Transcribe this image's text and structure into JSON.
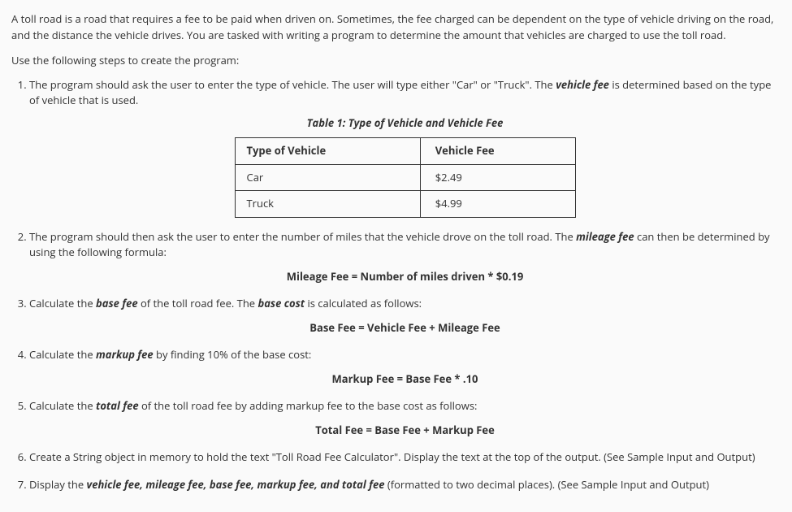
{
  "intro": "A toll road is a road that requires a fee to be paid when driven on.  Sometimes, the fee charged can be dependent on the type of vehicle driving on the road, and the distance the vehicle drives.  You are tasked with writing a program to determine the amount that vehicles are charged to use the toll road.",
  "steps_intro": "Use the following steps to create the program:",
  "step1": {
    "text_a": "The program should ask the user to enter the type of vehicle. The user will type either \"Car\" or \"Truck\".  The ",
    "bi": "vehicle fee",
    "text_b": " is determined based on the type of vehicle that is used."
  },
  "table": {
    "title": "Table 1: Type of Vehicle and Vehicle Fee",
    "h1": "Type of Vehicle",
    "h2": "Vehicle Fee",
    "r1c1": "Car",
    "r1c2": "$2.49",
    "r2c1": "Truck",
    "r2c2": "$4.99"
  },
  "step2": {
    "text_a": "The program should then ask the user to enter the number of miles that the vehicle drove on the toll road.  The ",
    "bi": "mileage fee",
    "text_b": " can then be determined by using the following formula:",
    "formula": "Mileage Fee = Number of miles driven * $0.19"
  },
  "step3": {
    "text_a": "Calculate the ",
    "bi_a": "base fee",
    "text_b": " of the toll road fee.  The ",
    "bi_b": "base cost",
    "text_c": " is calculated as follows:",
    "formula": "Base Fee = Vehicle Fee + Mileage Fee"
  },
  "step4": {
    "text_a": "Calculate the ",
    "bi": "markup fee",
    "text_b": " by finding 10% of the base cost:",
    "formula": "Markup Fee = Base Fee * .10"
  },
  "step5": {
    "text_a": "Calculate the ",
    "bi": "total fee",
    "text_b": " of the toll road fee by adding markup fee to the base cost as follows:",
    "formula": "Total Fee = Base Fee + Markup Fee"
  },
  "step6": "Create a String object in memory to hold the text \"Toll Road Fee Calculator\".  Display the text at the top of the output.  (See Sample Input and Output)",
  "step7": {
    "text_a": "Display the ",
    "bi": "vehicle fee, mileage fee, base fee, markup fee, and total fee",
    "text_b": " (formatted to two decimal places).  (See Sample Input and Output)"
  }
}
